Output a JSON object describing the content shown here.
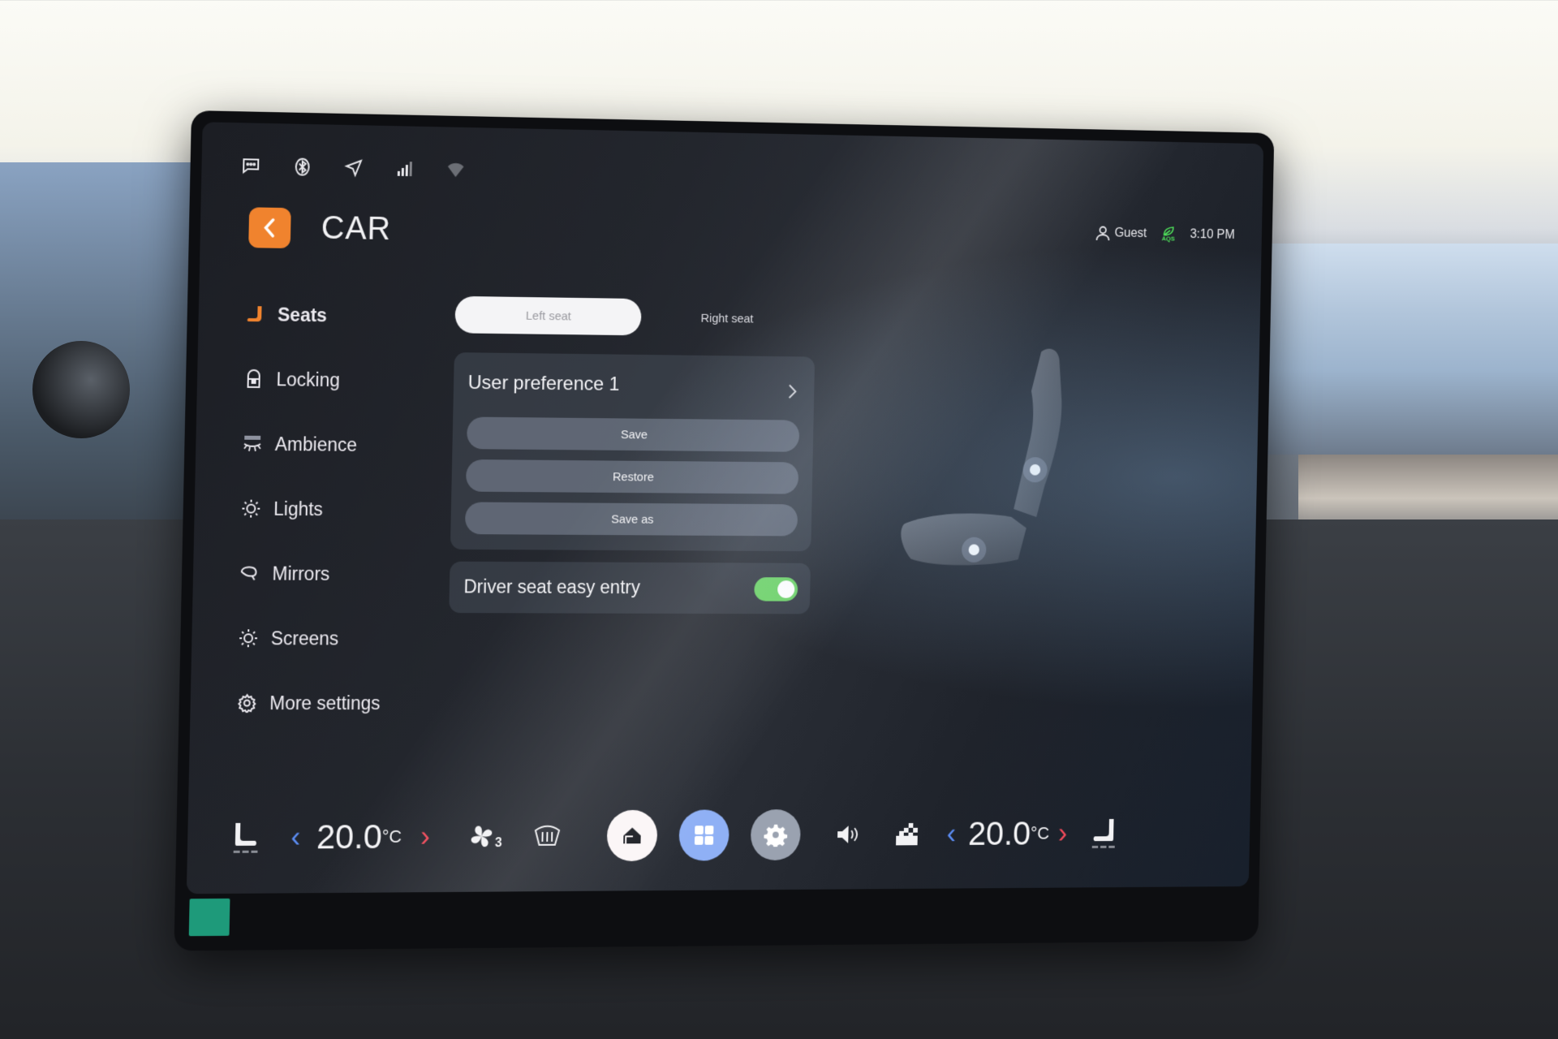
{
  "app": {
    "title": "CAR"
  },
  "status_icons": [
    "message-icon",
    "bluetooth-icon",
    "navigation-icon",
    "signal-icon",
    "wifi-icon"
  ],
  "header": {
    "user": "Guest",
    "aqs_label": "AQS",
    "time": "3:10 PM"
  },
  "sidebar": {
    "items": [
      {
        "label": "Seats",
        "icon": "seat-icon",
        "active": true
      },
      {
        "label": "Locking",
        "icon": "lock-icon",
        "active": false
      },
      {
        "label": "Ambience",
        "icon": "ambience-icon",
        "active": false
      },
      {
        "label": "Lights",
        "icon": "light-icon",
        "active": false
      },
      {
        "label": "Mirrors",
        "icon": "mirror-icon",
        "active": false
      },
      {
        "label": "Screens",
        "icon": "brightness-icon",
        "active": false
      },
      {
        "label": "More settings",
        "icon": "gear-icon",
        "active": false
      }
    ]
  },
  "seat_tabs": {
    "left": "Left seat",
    "right": "Right seat",
    "selected": "Left seat"
  },
  "preference": {
    "title": "User preference 1",
    "buttons": {
      "save": "Save",
      "restore": "Restore",
      "save_as": "Save as"
    }
  },
  "easy_entry": {
    "label": "Driver seat easy entry",
    "enabled": true
  },
  "climate": {
    "left_temp": "20.0",
    "right_temp": "20.0",
    "unit": "°C",
    "fan_level": "3"
  },
  "colors": {
    "accent_orange": "#f0832e",
    "toggle_green": "#6fd36a",
    "aqs_green": "#4ee05a",
    "temp_down_blue": "#5b8cf2",
    "temp_up_red": "#ef4a5a",
    "apps_blue": "#8fb0f5"
  }
}
